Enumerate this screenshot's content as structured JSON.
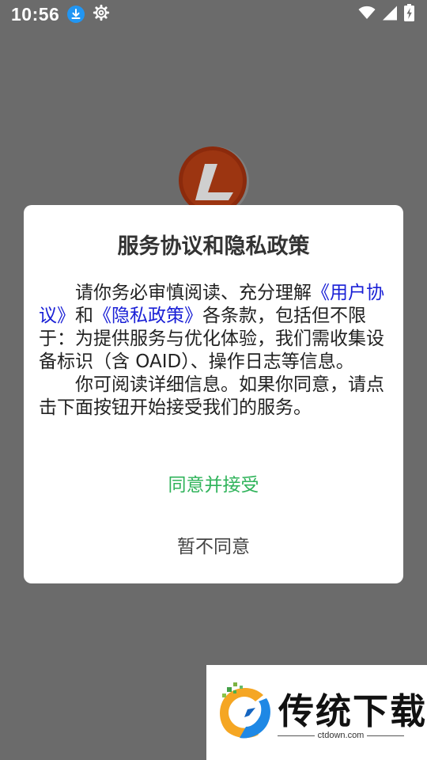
{
  "status_bar": {
    "time": "10:56",
    "icons": [
      "download-icon",
      "settings-icon",
      "wifi-icon",
      "signal-icon",
      "battery-charging-icon"
    ]
  },
  "background": {
    "app_icon": "app-logo-icon"
  },
  "dialog": {
    "title": "服务协议和隐私政策",
    "p1_before": "请你务必审慎阅读、充分理解",
    "user_agreement_link": "《用户协议》",
    "p1_and": "和",
    "privacy_policy_link": "《隐私政策》",
    "p1_after": "各条款，包括但不限于：为提供服务与优化体验，我们需收集设备标识（含 OAID）、操作日志等信息。",
    "p2": "你可阅读详细信息。如果你同意，请点击下面按钮开始接受我们的服务。",
    "agree_label": "同意并接受",
    "decline_label": "暂不同意"
  },
  "watermark": {
    "name": "传统下载",
    "url": "ctdown.com"
  },
  "colors": {
    "overlay": "#6b6b6b",
    "link": "#1a20d6",
    "agree": "#2fb35a",
    "download_badge": "#2196f3"
  }
}
